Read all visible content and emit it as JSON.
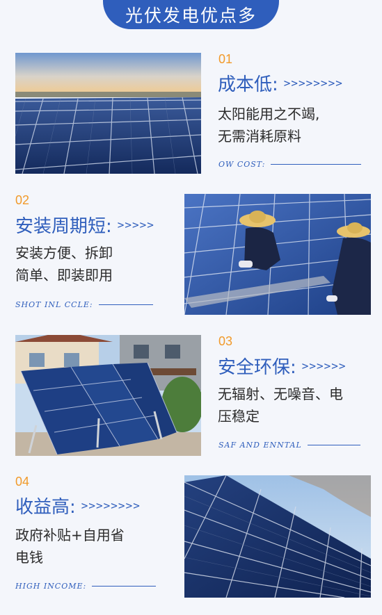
{
  "banner": {
    "title": "光伏发电优点多"
  },
  "items": [
    {
      "num": "01",
      "title": "成本低:",
      "chevrons": ">>>>>>>>",
      "desc1": "太阳能用之不竭,",
      "desc2": "无需消耗原料",
      "sub": "OW COST:"
    },
    {
      "num": "02",
      "title": "安装周期短:",
      "chevrons": ">>>>>",
      "desc1": "安装方便、拆卸",
      "desc2": "简单、即装即用",
      "sub": "SHOT INL CCLE:"
    },
    {
      "num": "03",
      "title": "安全环保:",
      "chevrons": ">>>>>>",
      "desc1": "无辐射、无噪音、电",
      "desc2": "压稳定",
      "sub": "SAF AND ENNTAL"
    },
    {
      "num": "04",
      "title": "收益高:",
      "chevrons": ">>>>>>>>",
      "desc1": "政府补贴+自用省",
      "desc2": "电钱",
      "sub": "HIGH INCOME:"
    }
  ],
  "colors": {
    "accent": "#2f5ebc",
    "number": "#f19a2a"
  }
}
